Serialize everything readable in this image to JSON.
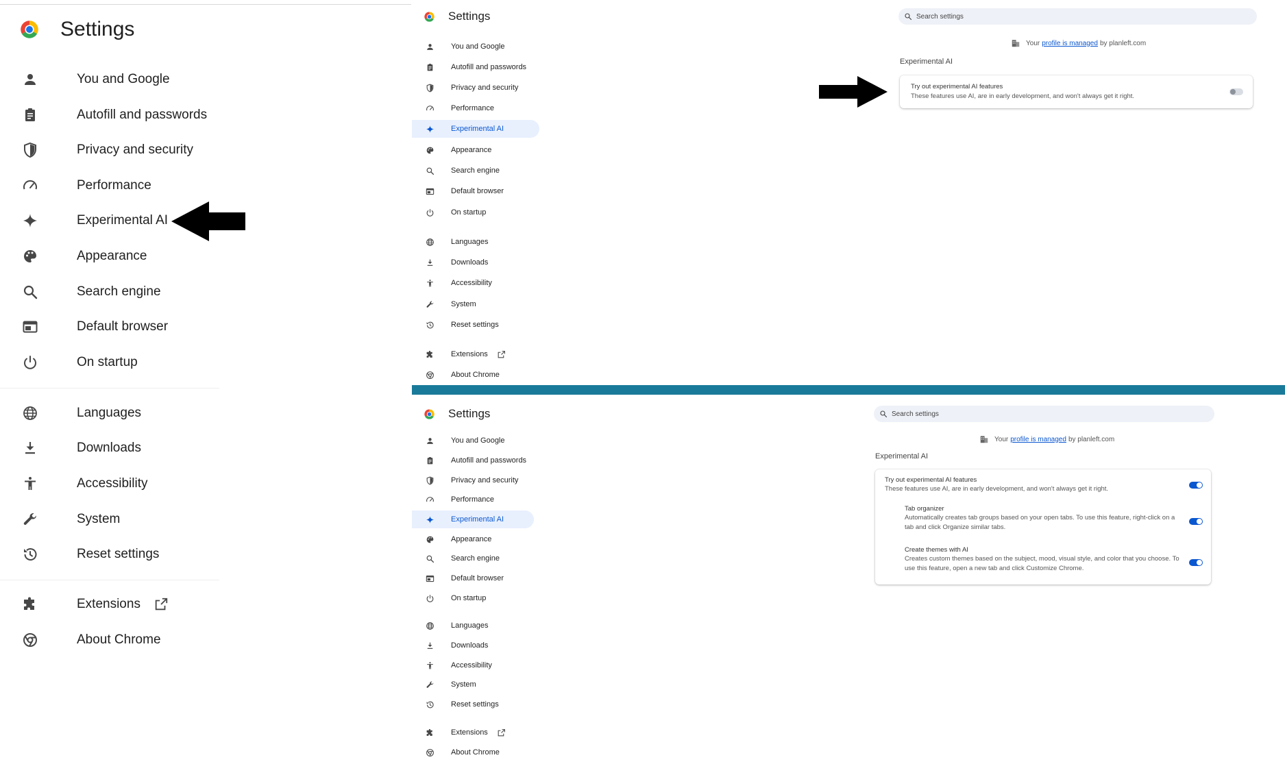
{
  "title": "Settings",
  "nav": [
    {
      "label": "You and Google",
      "icon": "person-icon"
    },
    {
      "label": "Autofill and passwords",
      "icon": "clipboard-icon"
    },
    {
      "label": "Privacy and security",
      "icon": "shield-icon"
    },
    {
      "label": "Performance",
      "icon": "gauge-icon"
    },
    {
      "label": "Experimental AI",
      "icon": "sparkle-icon"
    },
    {
      "label": "Appearance",
      "icon": "palette-icon"
    },
    {
      "label": "Search engine",
      "icon": "search-icon"
    },
    {
      "label": "Default browser",
      "icon": "browser-icon"
    },
    {
      "label": "On startup",
      "icon": "power-icon"
    },
    {
      "label": "Languages",
      "icon": "globe-icon"
    },
    {
      "label": "Downloads",
      "icon": "download-icon"
    },
    {
      "label": "Accessibility",
      "icon": "accessibility-icon"
    },
    {
      "label": "System",
      "icon": "wrench-icon"
    },
    {
      "label": "Reset settings",
      "icon": "history-icon"
    },
    {
      "label": "Extensions",
      "icon": "puzzle-icon"
    },
    {
      "label": "About Chrome",
      "icon": "chrome-icon"
    }
  ],
  "search": {
    "placeholder": "Search settings"
  },
  "managed": {
    "prefix": "Your",
    "link": "profile is managed",
    "suffix": "by planleft.com"
  },
  "section_title": "Experimental AI",
  "main_feature": {
    "title": "Try out experimental AI features",
    "desc": "These features use AI, are in early development, and won't always get it right."
  },
  "sub_features": [
    {
      "title": "Tab organizer",
      "desc1": "Automatically creates tab groups based on your open tabs. To use this feature, right-click on a",
      "desc2": "tab and click Organize similar tabs."
    },
    {
      "title": "Create themes with AI",
      "desc1": "Creates custom themes based on the subject, mood, visual style, and color that you choose. To",
      "desc2": "use this feature, open a new tab and click Customize Chrome."
    }
  ],
  "top_panel": {
    "main_toggle_on": false
  },
  "bottom_panel": {
    "main_toggle_on": true,
    "sub_toggles_on": [
      true,
      true
    ]
  },
  "colors": {
    "accent": "#0b57d0",
    "active_bg": "#e8f0fe",
    "divider_bar": "#1a7a9a"
  }
}
